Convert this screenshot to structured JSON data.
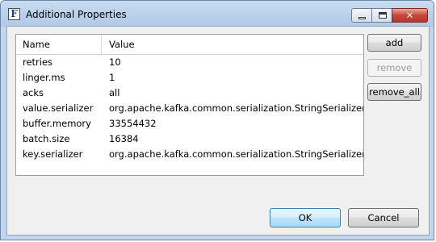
{
  "window": {
    "title": "Additional Properties",
    "app_icon_letter": "F",
    "close_glyph": "✕"
  },
  "table": {
    "columns": [
      "Name",
      "Value"
    ],
    "rows": [
      {
        "name": "retries",
        "value": "10"
      },
      {
        "name": "linger.ms",
        "value": "1"
      },
      {
        "name": "acks",
        "value": "all"
      },
      {
        "name": "value.serializer",
        "value": "org.apache.kafka.common.serialization.StringSerializer"
      },
      {
        "name": "buffer.memory",
        "value": "33554432"
      },
      {
        "name": "batch.size",
        "value": "16384"
      },
      {
        "name": "key.serializer",
        "value": "org.apache.kafka.common.serialization.StringSerializer"
      }
    ]
  },
  "buttons": {
    "add": "add",
    "remove": "remove",
    "remove_all": "remove_all",
    "ok": "OK",
    "cancel": "Cancel"
  },
  "states": {
    "remove_enabled": false
  }
}
